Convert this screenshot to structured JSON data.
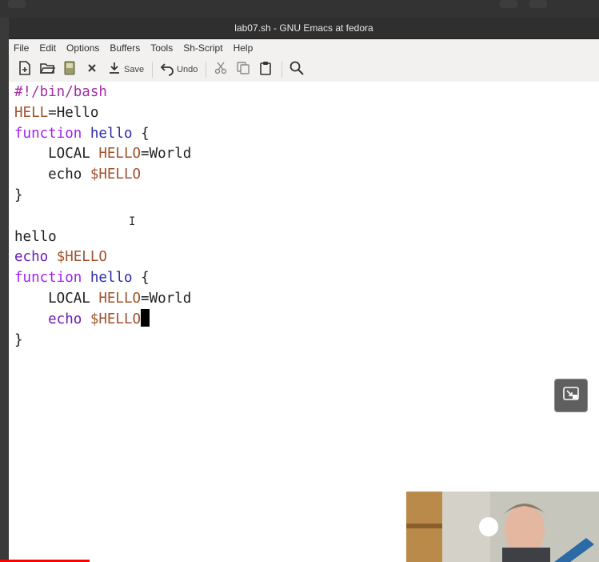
{
  "window": {
    "title": "lab07.sh - GNU Emacs at fedora"
  },
  "menubar": {
    "items": [
      "File",
      "Edit",
      "Options",
      "Buffers",
      "Tools",
      "Sh-Script",
      "Help"
    ]
  },
  "toolbar": {
    "save_label": "Save",
    "undo_label": "Undo",
    "icons": [
      "new-file-icon",
      "open-folder-icon",
      "save-disk-icon",
      "close-icon",
      "save-icon",
      "undo-icon",
      "cut-icon",
      "copy-icon",
      "paste-icon",
      "search-icon"
    ]
  },
  "editor": {
    "lines": [
      [
        {
          "t": "#!/bin/bash",
          "c": "comment"
        }
      ],
      [
        {
          "t": "HELL",
          "c": "var"
        },
        {
          "t": "=Hello",
          "c": ""
        }
      ],
      [
        {
          "t": "function",
          "c": "kw"
        },
        {
          "t": " ",
          "c": ""
        },
        {
          "t": "hello",
          "c": "fn"
        },
        {
          "t": " {",
          "c": ""
        }
      ],
      [
        {
          "t": "    LOCAL ",
          "c": ""
        },
        {
          "t": "HELLO",
          "c": "var"
        },
        {
          "t": "=World",
          "c": ""
        }
      ],
      [
        {
          "t": "    echo ",
          "c": ""
        },
        {
          "t": "$HELLO",
          "c": "var"
        }
      ],
      [
        {
          "t": "}",
          "c": ""
        }
      ],
      [],
      [
        {
          "t": "hello",
          "c": ""
        }
      ],
      [
        {
          "t": "echo ",
          "c": "kw2"
        },
        {
          "t": "$HELLO",
          "c": "var"
        }
      ],
      [
        {
          "t": "function",
          "c": "kw"
        },
        {
          "t": " ",
          "c": ""
        },
        {
          "t": "hello",
          "c": "fn"
        },
        {
          "t": " {",
          "c": ""
        }
      ],
      [
        {
          "t": "    LOCAL ",
          "c": ""
        },
        {
          "t": "HELLO",
          "c": "var"
        },
        {
          "t": "=World",
          "c": ""
        }
      ],
      [
        {
          "t": "    echo ",
          "c": "kw2"
        },
        {
          "t": "$HELLO",
          "c": "var"
        },
        {
          "cursor": true
        }
      ],
      [
        {
          "t": "}",
          "c": ""
        }
      ]
    ]
  },
  "colors": {
    "comment": "#a32fa3",
    "variable": "#a0522d",
    "keyword": "#a020f0",
    "function_name": "#2a2aaa",
    "video_progress": "#ff0000"
  },
  "video": {
    "progress_fraction": 0.15
  }
}
